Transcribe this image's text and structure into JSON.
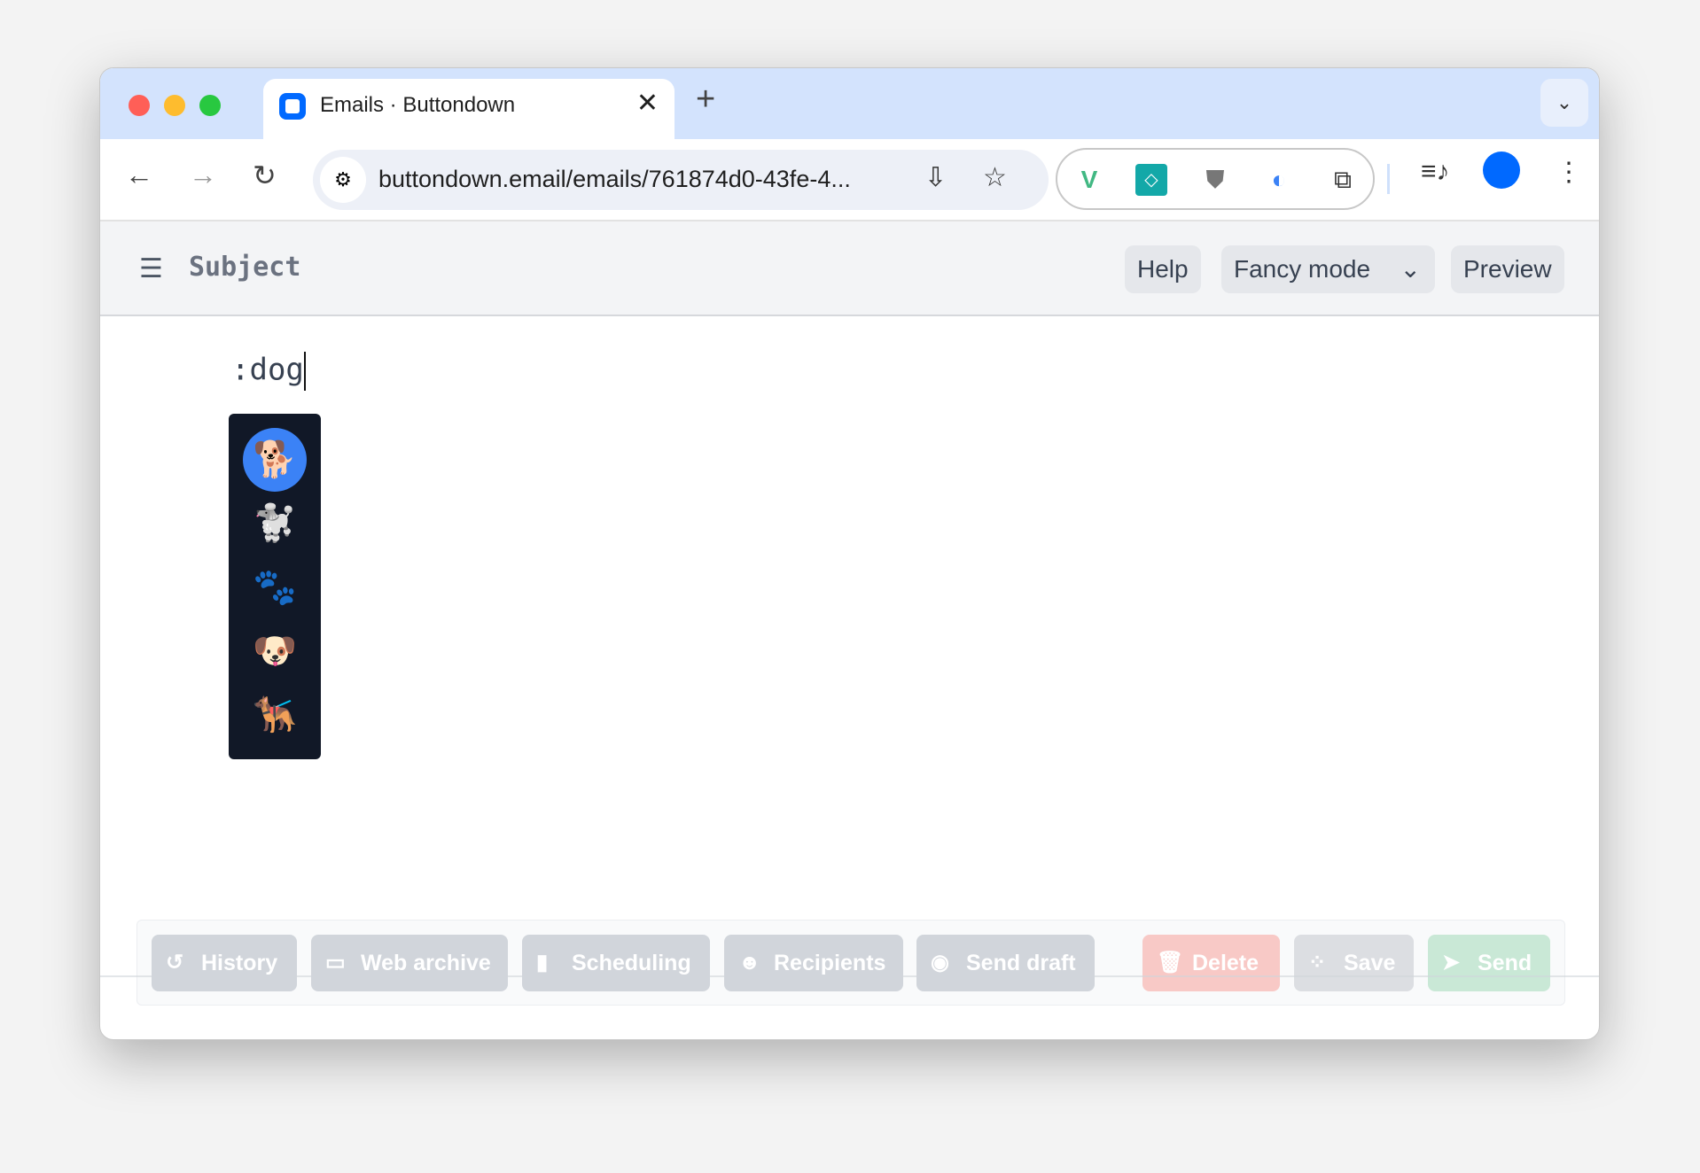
{
  "browser": {
    "tab_title": "Emails · Buttondown",
    "url": "buttondown.email/emails/761874d0-43fe-4...",
    "icons": [
      "back-icon",
      "forward-icon",
      "reload-icon",
      "site-settings-icon",
      "install-icon",
      "star-icon",
      "vue-devtools-icon",
      "extension-teal-icon",
      "ublock-icon",
      "1password-icon",
      "extensions-puzzle-icon",
      "media-icon",
      "profile-icon",
      "more-icon"
    ]
  },
  "header": {
    "title": "Subject",
    "help": "Help",
    "mode": "Fancy mode",
    "preview": "Preview"
  },
  "editor": {
    "text": ":dog"
  },
  "emoji_picker": {
    "items": [
      "🐕",
      "🐩",
      "🐾",
      "🐶",
      "🐕‍🦺"
    ],
    "selected_index": 0
  },
  "actions": {
    "history": "History",
    "web_archive": "Web archive",
    "scheduling": "Scheduling",
    "recipients": "Recipients",
    "send_draft": "Send draft",
    "delete": "Delete",
    "save": "Save",
    "send": "Send"
  },
  "colors": {
    "accent": "#3b82f6",
    "delete": "#f8c9c6",
    "send": "#c9e8d6",
    "popup_bg": "#111827"
  }
}
